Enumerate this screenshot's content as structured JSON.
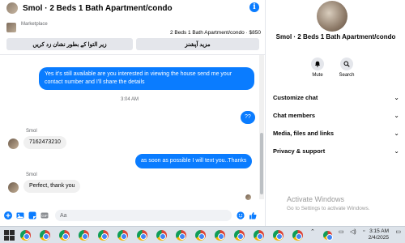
{
  "header": {
    "title": "Smol · 2 Beds 1 Bath Apartment/condo"
  },
  "marketplace": {
    "label": "Marketplace",
    "listing": "2 Beds 1 Bath Apartment/condo · $850",
    "btn_left": "زیر التوا کے بطور نشان زد کریں",
    "btn_right": "مزید آپشنز"
  },
  "messages": [
    {
      "type": "out",
      "text": "Yes it's still available are you interested in viewing the house send me your contact number and I'll share the details"
    },
    {
      "type": "time",
      "text": "3:04 AM"
    },
    {
      "type": "out",
      "text": "??"
    },
    {
      "type": "in",
      "sender": "Smol",
      "text": "7162473210"
    },
    {
      "type": "out",
      "text": "as soon as possible I will text you..Thanks"
    },
    {
      "type": "in",
      "sender": "Smol",
      "text": "Perfect, thank you"
    }
  ],
  "composer": {
    "placeholder": "Aa"
  },
  "side": {
    "name": "Smol · 2 Beds 1 Bath Apartment/condo",
    "mute": "Mute",
    "search": "Search",
    "rows": [
      "Customize chat",
      "Chat members",
      "Media, files and links",
      "Privacy & support"
    ],
    "watermark_title": "Activate Windows",
    "watermark_sub": "Go to Settings to activate Windows."
  },
  "taskbar": {
    "time": "3:15 AM",
    "date": "2/4/2025"
  },
  "colors": {
    "accent": "#0a7cff",
    "bubble_in": "#f0f0f0"
  }
}
